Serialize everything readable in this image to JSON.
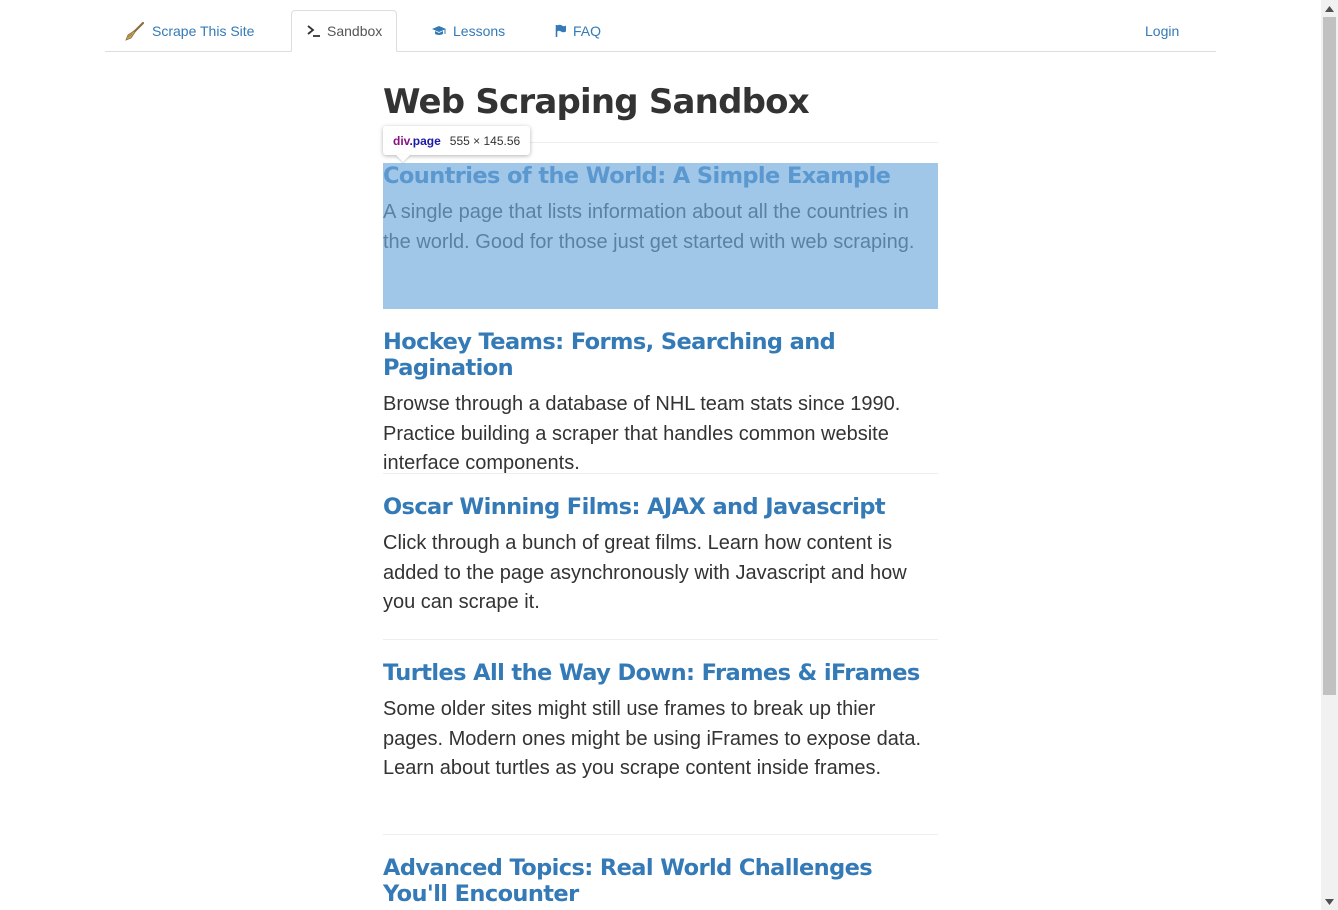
{
  "nav": {
    "brand_label": "Scrape This Site",
    "sandbox_label": "Sandbox",
    "lessons_label": "Lessons",
    "faq_label": "FAQ",
    "login_label": "Login",
    "icons": {
      "brand": "broom-icon",
      "sandbox": "terminal-icon",
      "lessons": "graduation-cap-icon",
      "faq": "flag-icon"
    }
  },
  "page": {
    "title": "Web Scraping Sandbox"
  },
  "inspector": {
    "tag": "div",
    "class": ".page",
    "dimensions": "555 × 145.56"
  },
  "items": [
    {
      "title": "Countries of the World: A Simple Example",
      "description": "A single page that lists information about all the countries in the world. Good for those just get started with web scraping."
    },
    {
      "title": "Hockey Teams: Forms, Searching and Pagination",
      "description": "Browse through a database of NHL team stats since 1990. Practice building a scraper that handles common website interface components."
    },
    {
      "title": "Oscar Winning Films: AJAX and Javascript",
      "description": "Click through a bunch of great films. Learn how content is added to the page asynchronously with Javascript and how you can scrape it."
    },
    {
      "title": "Turtles All the Way Down: Frames & iFrames",
      "description": "Some older sites might still use frames to break up thier pages. Modern ones might be using iFrames to expose data. Learn about turtles as you scrape content inside frames."
    },
    {
      "title": "Advanced Topics: Real World Challenges You'll Encounter",
      "description": ""
    }
  ],
  "colors": {
    "link": "#337ab7",
    "text": "#333333",
    "highlight": "#9fc3e7"
  }
}
